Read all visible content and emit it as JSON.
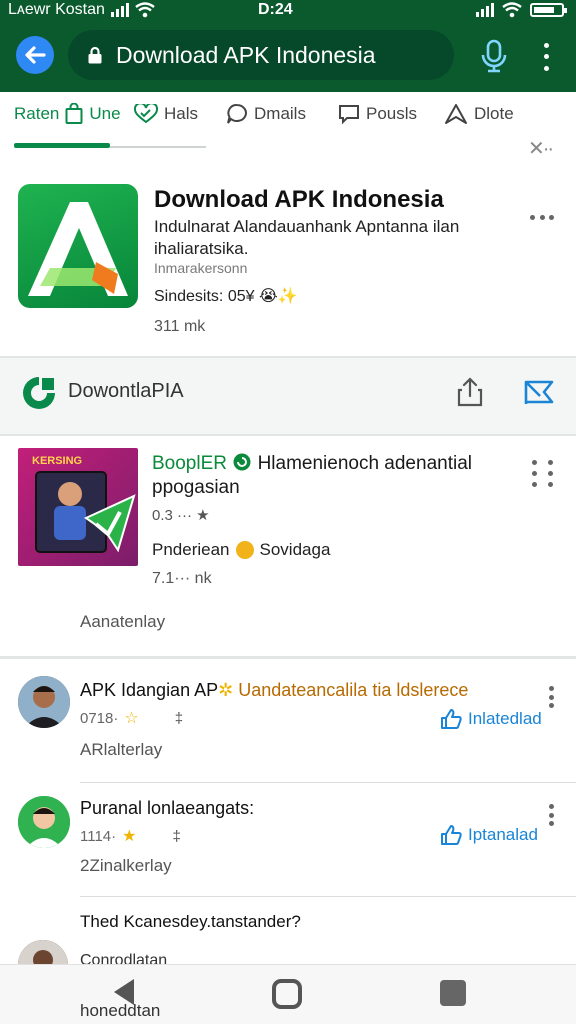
{
  "status_bar": {
    "carrier": "Lᴀewr Kostan",
    "time": "D:24"
  },
  "browser": {
    "url_title": "Download APK Indonesia"
  },
  "tabs": [
    {
      "label": "Raten",
      "label2": "Une",
      "icon": "shopping-bag-icon"
    },
    {
      "label": "Hals",
      "icon": "heart-icon"
    },
    {
      "label": "Dmails",
      "icon": "chat-bubble-icon"
    },
    {
      "label": "Pousls",
      "icon": "comment-icon"
    },
    {
      "label": "Dlote",
      "icon": "send-icon"
    }
  ],
  "app": {
    "title": "Download APK Indonesia",
    "description": "Indulnarat Alandauanhank Apntanna ilan ihaliaratsika.",
    "developer": "Inmarakersonn",
    "stats": "Sindesits: 05¥ 😭✨",
    "size": "311 mk"
  },
  "download_row": {
    "label": "DowontlaPIA"
  },
  "promo": {
    "title_highlight": "BooplER",
    "title_rest": "Hlamenienoch adenantial ppogasian",
    "rating": "0.3 ··· ★",
    "author": "Pnderiean",
    "author2": "Sovidaga",
    "size": "7.1··· nk",
    "link": "Aanatenlay",
    "image_text": "KERSING"
  },
  "reviews": [
    {
      "title": "APK Idangian AP",
      "title_highlight": "Uandateancalila tia ldslerece",
      "rating": "0718·",
      "action": "Inlatedlad",
      "sub": "ARlalterlay"
    },
    {
      "title": "Puranal lonlaeangats:",
      "title_highlight": "",
      "rating": "1114·",
      "action": "Iptanalad",
      "sub": "2Zinalkerlay"
    }
  ],
  "question": "Thed Kcanesdey.tanstander?",
  "partial_review": "Conrodlatan",
  "bottom_nav": {
    "caption": "honeddtan"
  },
  "colors": {
    "header_green": "#0b5a2e",
    "accent_green": "#0a8a4a",
    "link_blue": "#1a84d6",
    "back_blue": "#2f89f5"
  }
}
